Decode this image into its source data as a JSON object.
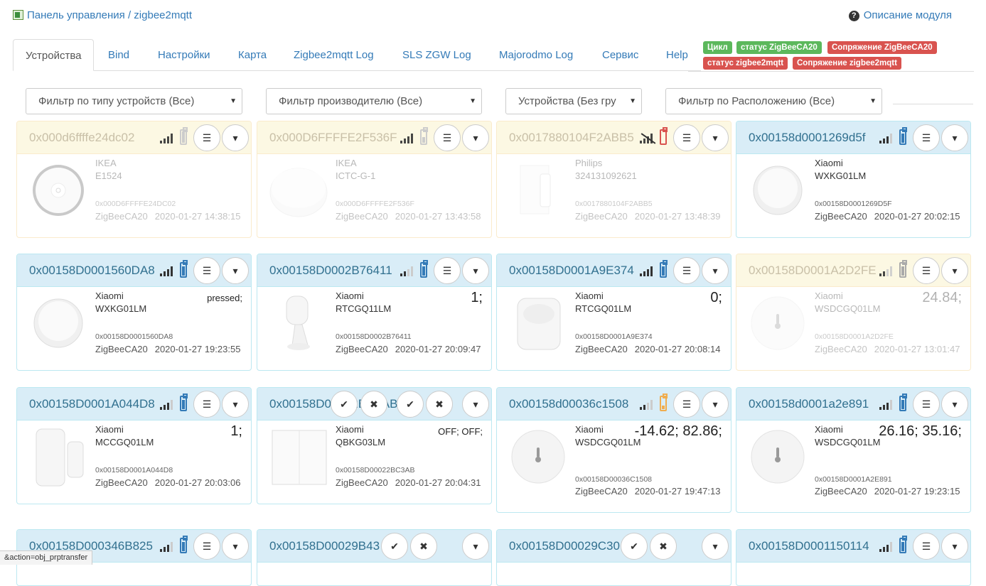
{
  "breadcrumb": "Панель управления / zigbee2mqtt",
  "help_link": "Описание модуля",
  "tabs": [
    "Устройства",
    "Bind",
    "Настройки",
    "Карта",
    "Zigbee2mqtt Log",
    "SLS ZGW Log",
    "Majorodmo Log",
    "Сервис",
    "Help"
  ],
  "badges": [
    {
      "label": "Цикл",
      "color": "#5cb85c"
    },
    {
      "label": "статус ZigBeeCA20",
      "color": "#5cb85c"
    },
    {
      "label": "Сопряжение ZigBeeCA20",
      "color": "#d9534f"
    },
    {
      "label": "статус zigbee2mqtt",
      "color": "#d9534f"
    },
    {
      "label": "Сопряжение zigbee2mqtt",
      "color": "#d9534f"
    }
  ],
  "filters": [
    "Фильтр по типу устройств (Все)",
    "Фильтр производителю (Все)",
    "Устройства (Без гру",
    "Фильтр по Расположению (Все)"
  ],
  "colors": {
    "link": "#337ab7",
    "info_header": "#d9edf7",
    "warning_header": "#fcf8e3",
    "battery_low": "#d9534f",
    "battery_mid": "#f0ad4e"
  },
  "devices": [
    {
      "id": "0x000d6ffffe24dc02",
      "mfr": "IKEA",
      "model": "E1524",
      "ieee": "0x000D6FFFFE24DC02",
      "gw": "ZigBeeCA20",
      "time": "2020-01-27 14:38:15",
      "value": "",
      "img": "remote-round",
      "style": "warn-dim"
    },
    {
      "id": "0x000D6FFFFE2F536F",
      "mfr": "IKEA",
      "model": "ICTC-G-1",
      "ieee": "0x000D6FFFFE2F536F",
      "gw": "ZigBeeCA20",
      "time": "2020-01-27 13:43:58",
      "value": "",
      "img": "puck",
      "style": "warn-dim"
    },
    {
      "id": "0x0017880104F2ABB5",
      "mfr": "Philips",
      "model": "324131092621",
      "ieee": "0x0017880104F2ABB5",
      "gw": "ZigBeeCA20",
      "time": "2020-01-27 13:48:39",
      "value": "",
      "img": "switch-remote",
      "style": "warn-dim"
    },
    {
      "id": "0x00158d0001269d5f",
      "mfr": "Xiaomi",
      "model": "WXKG01LM",
      "ieee": "0x00158D0001269D5F",
      "gw": "ZigBeeCA20",
      "time": "2020-01-27 20:02:15",
      "value": "",
      "img": "button-round",
      "style": "info"
    },
    {
      "id": "0x00158D0001560DA8",
      "mfr": "Xiaomi",
      "model": "WXKG01LM",
      "ieee": "0x00158D0001560DA8",
      "gw": "ZigBeeCA20",
      "time": "2020-01-27 19:23:55",
      "value": "pressed;",
      "img": "button-round",
      "style": "info"
    },
    {
      "id": "0x00158D0002B76411",
      "mfr": "Xiaomi",
      "model": "RTCGQ11LM",
      "ieee": "0x00158D0002B76411",
      "gw": "ZigBeeCA20",
      "time": "2020-01-27 20:09:47",
      "value": "1;",
      "img": "motion-stand",
      "style": "info"
    },
    {
      "id": "0x00158D0001A9E374",
      "mfr": "Xiaomi",
      "model": "RTCGQ01LM",
      "ieee": "0x00158D0001A9E374",
      "gw": "ZigBeeCA20",
      "time": "2020-01-27 20:08:14",
      "value": "0;",
      "img": "motion-cube",
      "style": "info"
    },
    {
      "id": "0x00158D0001A2D2FE",
      "mfr": "Xiaomi",
      "model": "WSDCGQ01LM",
      "ieee": "0x00158D0001A2D2FE",
      "gw": "ZigBeeCA20",
      "time": "2020-01-27 13:01:47",
      "value": "24.84;",
      "img": "thermo",
      "style": "warn-dim"
    },
    {
      "id": "0x00158D0001A044D8",
      "mfr": "Xiaomi",
      "model": "MCCGQ01LM",
      "ieee": "0x00158D0001A044D8",
      "gw": "ZigBeeCA20",
      "time": "2020-01-27 20:03:06",
      "value": "1;",
      "img": "door",
      "style": "info"
    },
    {
      "id": "0x00158D00022BC3AB",
      "mfr": "Xiaomi",
      "model": "QBKG03LM",
      "ieee": "0x00158D00022BC3AB",
      "gw": "ZigBeeCA20",
      "time": "2020-01-27 20:04:31",
      "value": "OFF; OFF;",
      "img": "wallswitch",
      "style": "info"
    },
    {
      "id": "0x00158d00036c1508",
      "mfr": "Xiaomi",
      "model": "WSDCGQ01LM",
      "ieee": "0x00158D00036C1508",
      "gw": "ZigBeeCA20",
      "time": "2020-01-27 19:47:13",
      "value": "-14.62; 82.86;",
      "img": "thermo",
      "style": "info"
    },
    {
      "id": "0x00158d0001a2e891",
      "mfr": "Xiaomi",
      "model": "WSDCGQ01LM",
      "ieee": "0x00158D0001A2E891",
      "gw": "ZigBeeCA20",
      "time": "2020-01-27 19:23:15",
      "value": "26.16; 35.16;",
      "img": "thermo",
      "style": "info"
    },
    {
      "id": "0x00158D000346B825",
      "style": "info"
    },
    {
      "id": "0x00158D00029B43",
      "style": "info"
    },
    {
      "id": "0x00158D00029C30",
      "style": "info"
    },
    {
      "id": "0x00158D0001150114",
      "style": "info"
    }
  ],
  "statusbar": "&action=obj_prptransfer"
}
